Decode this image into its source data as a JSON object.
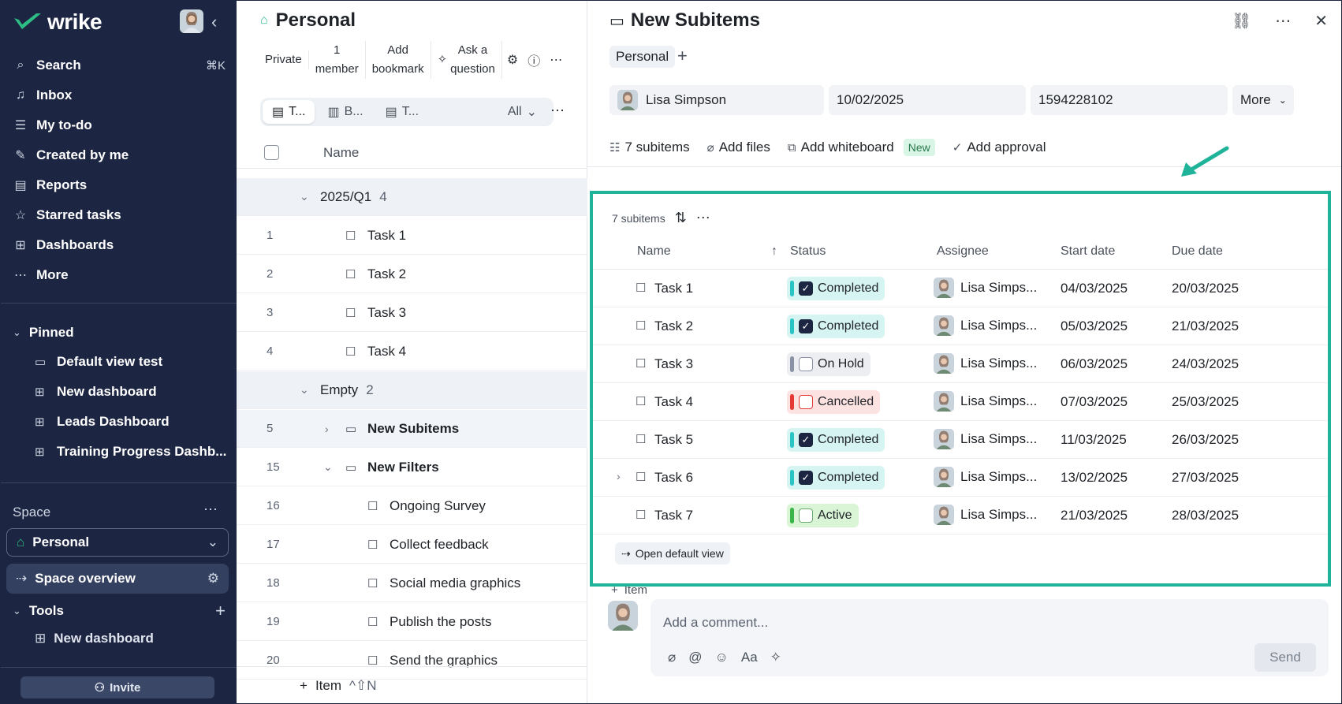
{
  "sidebar": {
    "brand": "wrike",
    "nav": [
      {
        "label": "Search",
        "icon": "search-icon",
        "shortcut": "⌘K"
      },
      {
        "label": "Inbox",
        "icon": "bell-icon"
      },
      {
        "label": "My to-do",
        "icon": "user-list-icon"
      },
      {
        "label": "Created by me",
        "icon": "user-edit-icon"
      },
      {
        "label": "Reports",
        "icon": "report-icon"
      },
      {
        "label": "Starred tasks",
        "icon": "star-icon"
      },
      {
        "label": "Dashboards",
        "icon": "dashboard-icon"
      },
      {
        "label": "More",
        "icon": "more-icon"
      }
    ],
    "pinned_label": "Pinned",
    "pinned": [
      {
        "label": "Default view test",
        "icon": "folder-icon"
      },
      {
        "label": "New dashboard",
        "icon": "dashboard-icon"
      },
      {
        "label": "Leads Dashboard",
        "icon": "dashboard-icon"
      },
      {
        "label": "Training Progress Dashb...",
        "icon": "dashboard-icon"
      }
    ],
    "space_label": "Space",
    "space_selected": "Personal",
    "space_overview": "Space overview",
    "tools_label": "Tools",
    "tools_item": "New dashboard",
    "invite": "Invite"
  },
  "middle": {
    "title": "Personal",
    "toolbar": {
      "private": "Private",
      "members_line1": "1",
      "members_line2": "member",
      "bookmark_line1": "Add",
      "bookmark_line2": "bookmark",
      "ask_line1": "Ask a",
      "ask_line2": "question"
    },
    "view_tabs": [
      "T...",
      "B...",
      "T..."
    ],
    "filter_all": "All",
    "col_name": "Name",
    "rows": [
      {
        "type": "group",
        "label": "2025/Q1",
        "count": "4"
      },
      {
        "type": "task",
        "num": "1",
        "label": "Task 1"
      },
      {
        "type": "task",
        "num": "2",
        "label": "Task 2"
      },
      {
        "type": "task",
        "num": "3",
        "label": "Task 3"
      },
      {
        "type": "task",
        "num": "4",
        "label": "Task 4"
      },
      {
        "type": "group",
        "label": "Empty",
        "count": "2"
      },
      {
        "type": "folder",
        "num": "5",
        "label": "New Subitems",
        "selected": true
      },
      {
        "type": "folder-open",
        "num": "15",
        "label": "New Filters"
      },
      {
        "type": "subtask",
        "num": "16",
        "label": "Ongoing Survey"
      },
      {
        "type": "subtask",
        "num": "17",
        "label": "Collect feedback"
      },
      {
        "type": "subtask",
        "num": "18",
        "label": "Social media graphics"
      },
      {
        "type": "subtask",
        "num": "19",
        "label": "Publish the posts"
      },
      {
        "type": "subtask",
        "num": "20",
        "label": "Send the graphics"
      }
    ],
    "footer_item": "Item",
    "footer_shortcut": "^⇧N"
  },
  "detail": {
    "title": "New Subitems",
    "tag": "Personal",
    "assignee": "Lisa Simpson",
    "date": "10/02/2025",
    "id": "1594228102",
    "more": "More",
    "links": {
      "subitems": "7 subitems",
      "files": "Add files",
      "whiteboard": "Add whiteboard",
      "new_badge": "New",
      "approval": "Add approval"
    },
    "subitems": {
      "count_label": "7 subitems",
      "columns": {
        "name": "Name",
        "status": "Status",
        "assignee": "Assignee",
        "start": "Start date",
        "due": "Due date"
      },
      "rows": [
        {
          "name": "Task 1",
          "status": "Completed",
          "kind": "completed",
          "assignee": "Lisa Simps...",
          "start": "04/03/2025",
          "due": "20/03/2025"
        },
        {
          "name": "Task 2",
          "status": "Completed",
          "kind": "completed",
          "assignee": "Lisa Simps...",
          "start": "05/03/2025",
          "due": "21/03/2025"
        },
        {
          "name": "Task 3",
          "status": "On Hold",
          "kind": "hold",
          "assignee": "Lisa Simps...",
          "start": "06/03/2025",
          "due": "24/03/2025"
        },
        {
          "name": "Task 4",
          "status": "Cancelled",
          "kind": "cancelled",
          "assignee": "Lisa Simps...",
          "start": "07/03/2025",
          "due": "25/03/2025"
        },
        {
          "name": "Task 5",
          "status": "Completed",
          "kind": "completed",
          "assignee": "Lisa Simps...",
          "start": "11/03/2025",
          "due": "26/03/2025"
        },
        {
          "name": "Task 6",
          "status": "Completed",
          "kind": "completed",
          "assignee": "Lisa Simps...",
          "start": "13/02/2025",
          "due": "27/03/2025",
          "expandable": true
        },
        {
          "name": "Task 7",
          "status": "Active",
          "kind": "active",
          "assignee": "Lisa Simps...",
          "start": "21/03/2025",
          "due": "28/03/2025"
        }
      ],
      "open_default": "Open default view"
    },
    "add_item": "Item",
    "comment_placeholder": "Add a comment...",
    "send": "Send"
  },
  "colors": {
    "sidebar_bg": "#1c2541",
    "accent_green": "#1fb39a",
    "completed_bg": "#d6f4f1",
    "completed_bar": "#2bc4c4",
    "hold_bg": "#eceef2",
    "hold_bar": "#8a93a6",
    "cancelled_bg": "#fde2e2",
    "cancelled_bar": "#e53935",
    "active_bg": "#d9f5d6",
    "active_bar": "#3ab54a"
  }
}
